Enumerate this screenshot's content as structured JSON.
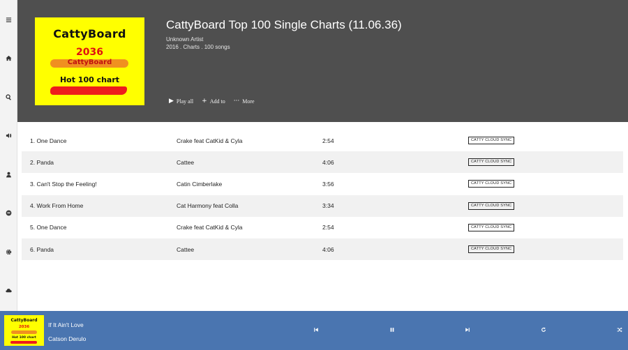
{
  "sidebar": {
    "icons": [
      "menu-icon",
      "home-icon",
      "search-icon",
      "volume-icon",
      "user-icon",
      "list-icon",
      "gear-icon",
      "cloud-icon"
    ]
  },
  "album": {
    "cover": {
      "brand": "CattyBoard",
      "year": "2036",
      "subtitle": "CattyBoard",
      "chart": "Hot 100 chart"
    },
    "title": "CattyBoard Top 100 Single Charts (11.06.36)",
    "artist": "Unknown Artist",
    "meta": "2016 . Charts . 100 songs",
    "actions": {
      "play_all": "Play all",
      "add_to": "Add to",
      "more": "More"
    }
  },
  "tracks": [
    {
      "name": "1. One Dance",
      "artist": "Crake feat CatKid & Cyla",
      "duration": "2:54",
      "badge": "CATTY CLOUD SYNC"
    },
    {
      "name": "2. Panda",
      "artist": "Cattee",
      "duration": "4:06",
      "badge": "CATTY CLOUD SYNC"
    },
    {
      "name": "3. Can't Stop the Feeling!",
      "artist": "Catin Cimberlake",
      "duration": "3:56",
      "badge": "CATTY CLOUD SYNC"
    },
    {
      "name": "4. Work From Home",
      "artist": "Cat Harmony feat Colla",
      "duration": "3:34",
      "badge": "CATTY CLOUD SYNC"
    },
    {
      "name": "5. One Dance",
      "artist": "Crake feat CatKid & Cyla",
      "duration": "2:54",
      "badge": "CATTY CLOUD SYNC"
    },
    {
      "name": "6. Panda",
      "artist": "Cattee",
      "duration": "4:06",
      "badge": "CATTY CLOUD SYNC"
    }
  ],
  "player": {
    "cover": {
      "brand": "CattyBoard",
      "year": "2036",
      "chart": "Hot 100 chart"
    },
    "song": "If It Ain't Love",
    "artist": "Catson Derulo",
    "controls": [
      "previous-icon",
      "pause-icon",
      "next-icon",
      "repeat-icon",
      "shuffle-icon"
    ]
  },
  "colors": {
    "header_bg": "#4f4f4f",
    "player_bg": "#4a75b0",
    "row_stripe": "#f1f1f1",
    "cover_yellow": "#ffff00"
  }
}
